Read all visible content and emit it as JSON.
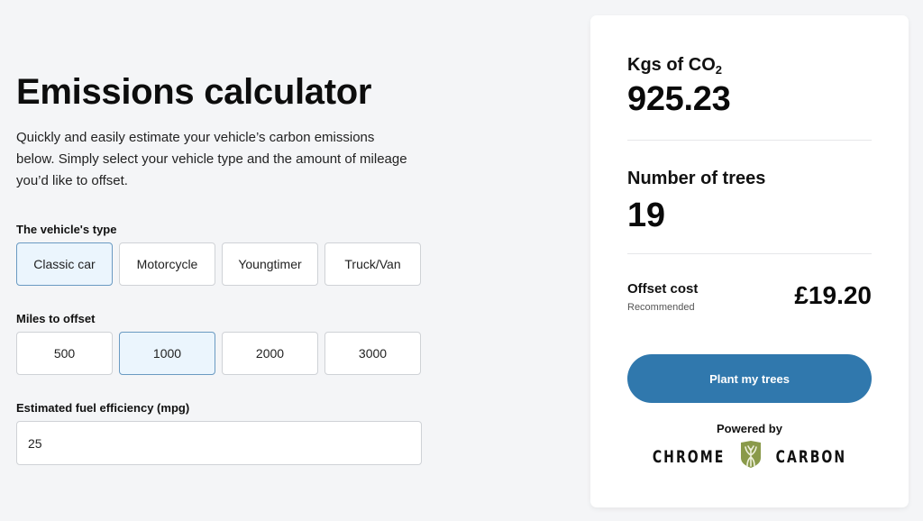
{
  "page": {
    "title": "Emissions calculator",
    "description": "Quickly and easily estimate your vehicle’s carbon emissions below. Simply select your vehicle type and the amount of mileage you’d like to offset."
  },
  "vehicle_type": {
    "label": "The vehicle's type",
    "options": [
      "Classic car",
      "Motorcycle",
      "Youngtimer",
      "Truck/Van"
    ],
    "selected": "Classic car"
  },
  "miles": {
    "label": "Miles to offset",
    "options": [
      "500",
      "1000",
      "2000",
      "3000"
    ],
    "selected": "1000"
  },
  "fuel": {
    "label": "Estimated fuel efficiency (mpg)",
    "value": "25"
  },
  "results": {
    "co2_label": "Kgs of CO",
    "co2_sub": "2",
    "co2_value": "925.23",
    "trees_label": "Number of trees",
    "trees_value": "19",
    "offset_label": "Offset cost",
    "offset_sub": "Recommended",
    "offset_price": "£19.20",
    "cta_label": "Plant my trees",
    "powered_by": "Powered by",
    "brand_left": "CHROME",
    "brand_right": "CARBON"
  },
  "colors": {
    "accent": "#3078ad",
    "selected_bg": "#ebf5fd",
    "selected_border": "#6a9ac2",
    "logo_green": "#8a9a4a"
  }
}
